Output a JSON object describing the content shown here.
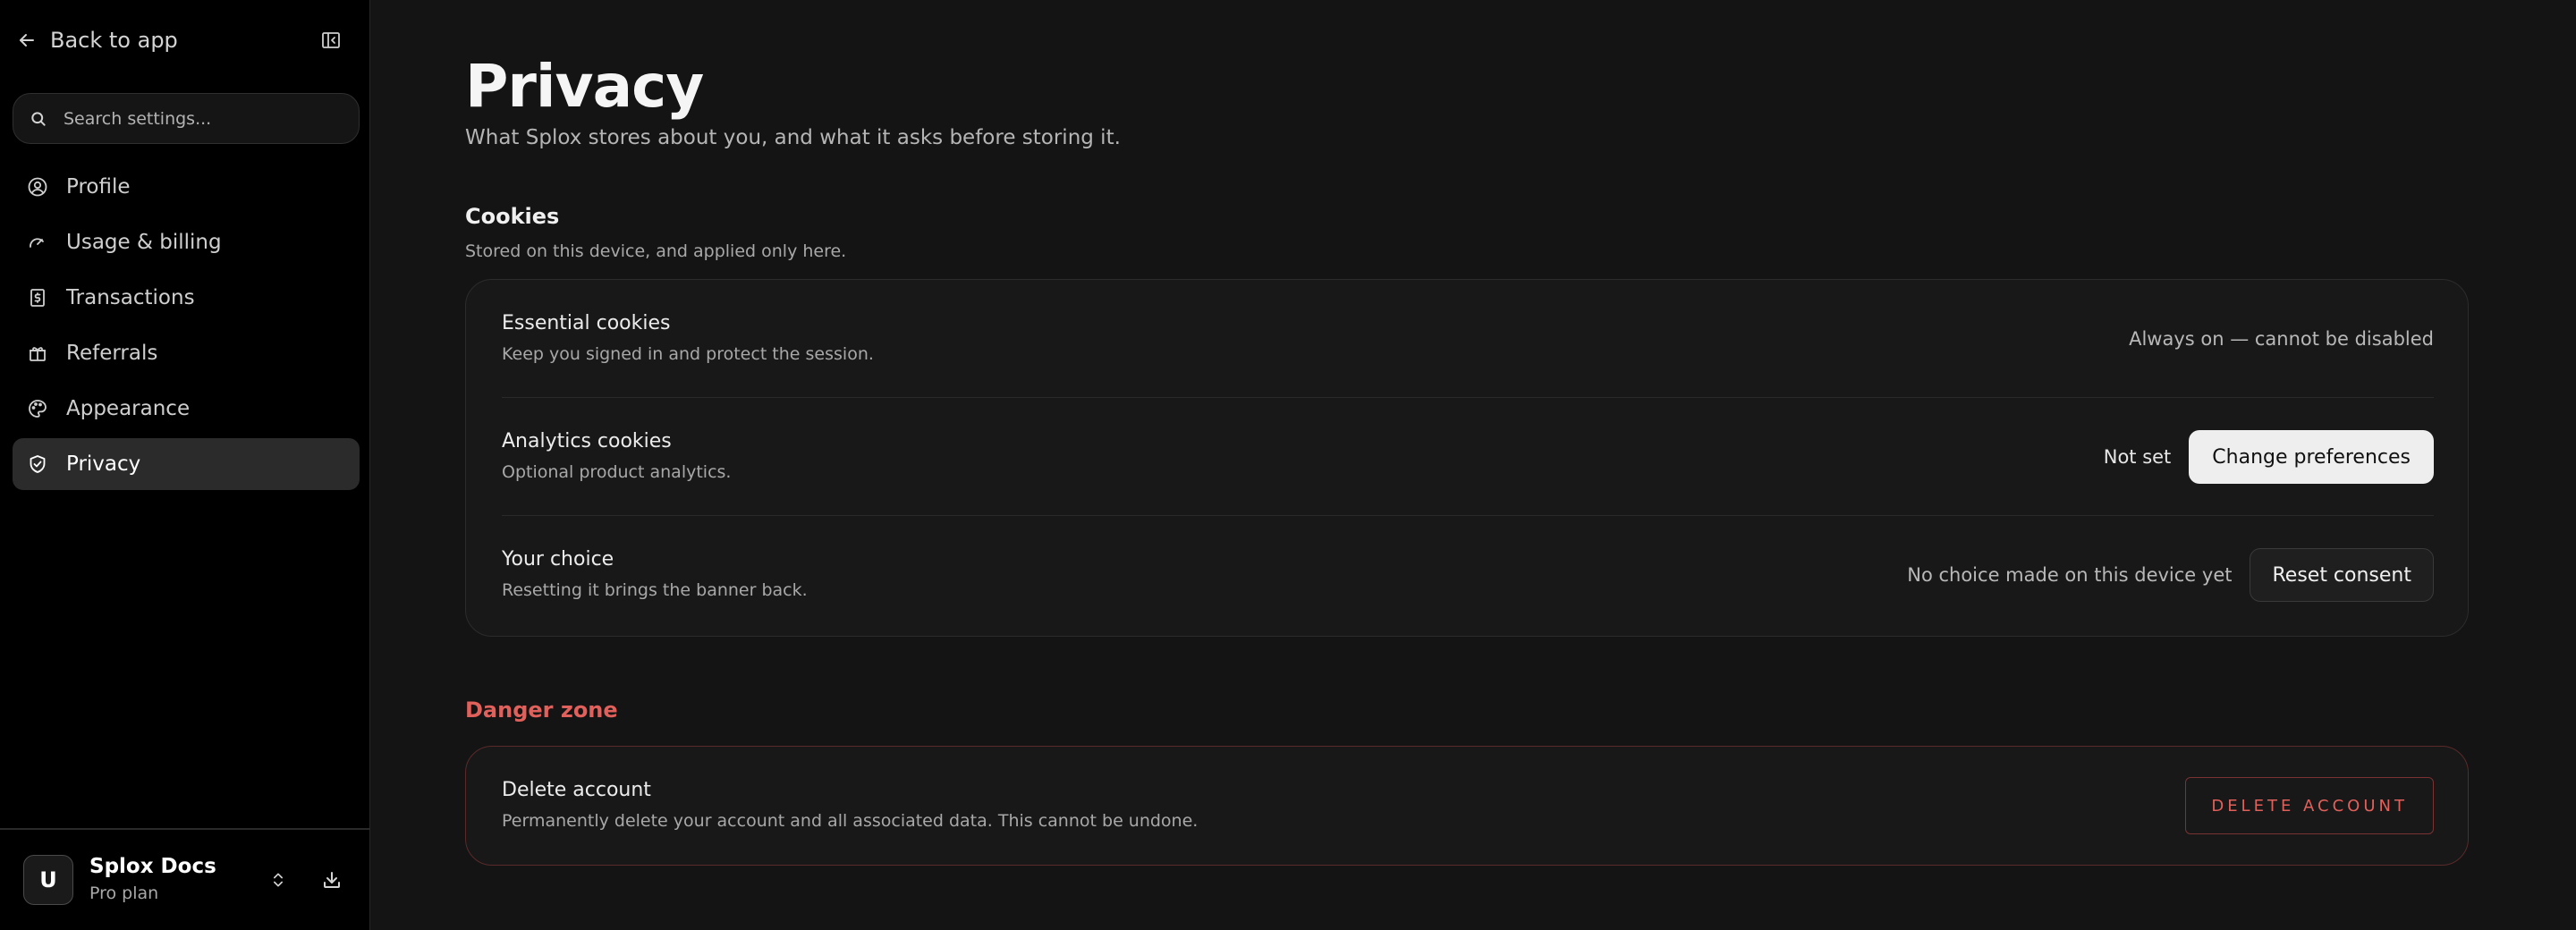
{
  "sidebar": {
    "back_label": "Back to app",
    "search_placeholder": "Search settings...",
    "items": [
      {
        "label": "Profile",
        "icon": "user-circle-icon"
      },
      {
        "label": "Usage & billing",
        "icon": "gauge-icon"
      },
      {
        "label": "Transactions",
        "icon": "receipt-dollar-icon"
      },
      {
        "label": "Referrals",
        "icon": "gift-icon"
      },
      {
        "label": "Appearance",
        "icon": "palette-icon"
      },
      {
        "label": "Privacy",
        "icon": "shield-check-icon",
        "active": true
      }
    ],
    "account": {
      "avatar_letter": "U",
      "name": "Splox Docs",
      "plan": "Pro plan"
    }
  },
  "main": {
    "title": "Privacy",
    "subtitle": "What Splox stores about you, and what it asks before storing it.",
    "cookies": {
      "title": "Cookies",
      "description": "Stored on this device, and applied only here.",
      "rows": [
        {
          "title": "Essential cookies",
          "description": "Keep you signed in and protect the session.",
          "status": "Always on — cannot be disabled"
        },
        {
          "title": "Analytics cookies",
          "description": "Optional product analytics.",
          "status": "Not set",
          "button": "Change preferences"
        },
        {
          "title": "Your choice",
          "description": "Resetting it brings the banner back.",
          "status": "No choice made on this device yet",
          "button": "Reset consent"
        }
      ]
    },
    "danger": {
      "title": "Danger zone",
      "row_title": "Delete account",
      "row_description": "Permanently delete your account and all associated data. This cannot be undone.",
      "button": "DELETE ACCOUNT"
    }
  },
  "colors": {
    "background": "#141414",
    "sidebar": "#000000",
    "danger": "#e0605b",
    "active_nav": "#2b2b2b"
  }
}
